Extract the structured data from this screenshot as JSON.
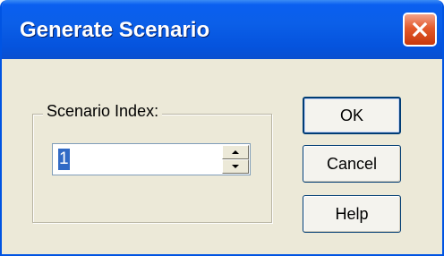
{
  "window": {
    "title": "Generate Scenario"
  },
  "group": {
    "label": "Scenario Index:"
  },
  "spinner": {
    "value": "1"
  },
  "buttons": {
    "ok": "OK",
    "cancel": "Cancel",
    "help": "Help"
  },
  "icons": {
    "close": "close-icon",
    "spin_up": "spin-up-arrow-icon",
    "spin_down": "spin-down-arrow-icon"
  },
  "colors": {
    "titlebar": "#0553dd",
    "dialog_bg": "#ece9d8",
    "close_button": "#e35a2c",
    "selection": "#316ac5"
  }
}
